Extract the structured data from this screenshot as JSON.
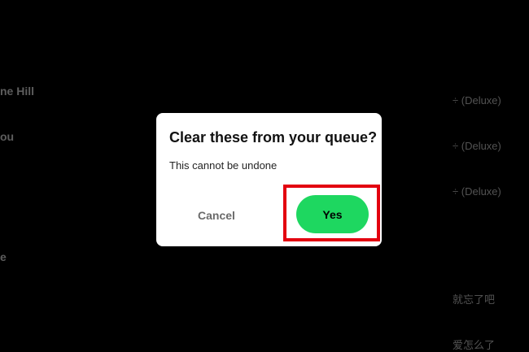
{
  "background_queue": {
    "rows": [
      {
        "title": "ne Hill",
        "album": "÷ (Deluxe)"
      },
      {
        "title": "ou",
        "album": "÷ (Deluxe)"
      },
      {
        "title": "",
        "album": "÷ (Deluxe)"
      },
      {
        "title": "e",
        "album": ""
      },
      {
        "title": "",
        "album": "就忘了吧"
      },
      {
        "title": "",
        "album": "爱怎么了"
      }
    ]
  },
  "dialog": {
    "title": "Clear these from your queue?",
    "message": "This cannot be undone",
    "cancel_label": "Cancel",
    "confirm_label": "Yes"
  },
  "colors": {
    "background": "#000000",
    "dialog_bg": "#ffffff",
    "confirm_button": "#1ed760",
    "highlight": "#e3000f"
  }
}
